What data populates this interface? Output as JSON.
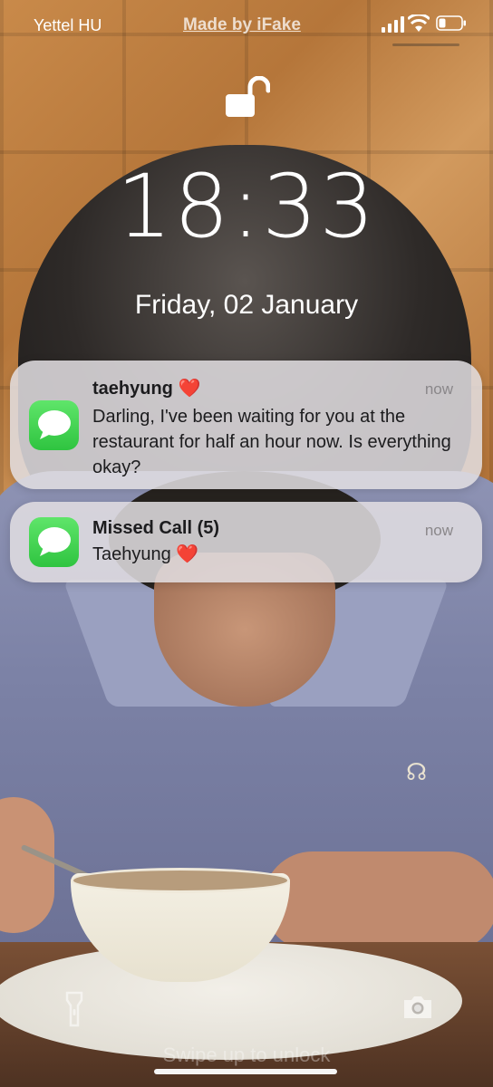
{
  "status_bar": {
    "carrier": "Yettel HU",
    "watermark": "Made by iFake",
    "icons": [
      "signal-bars-icon",
      "wifi-icon",
      "battery-icon"
    ]
  },
  "lock_screen": {
    "lock_icon": "unlocked-padlock-icon",
    "time": "18:33",
    "date": "Friday, 02 January"
  },
  "notifications": [
    {
      "app_icon": "messages-icon",
      "title": "taehyung ❤️",
      "time": "now",
      "body": "Darling, I've been waiting for you at the restaurant for half an hour now. Is everything okay?"
    },
    {
      "app_icon": "messages-icon",
      "title": "Missed Call (5)",
      "time": "now",
      "body": "Taehyung ❤️"
    }
  ],
  "bottom": {
    "flashlight_icon": "flashlight-icon",
    "camera_icon": "camera-icon",
    "swipe_hint": "Swipe up to unlock"
  },
  "colors": {
    "messages_green": "#34c84a",
    "notification_bg": "#e2dee2"
  }
}
